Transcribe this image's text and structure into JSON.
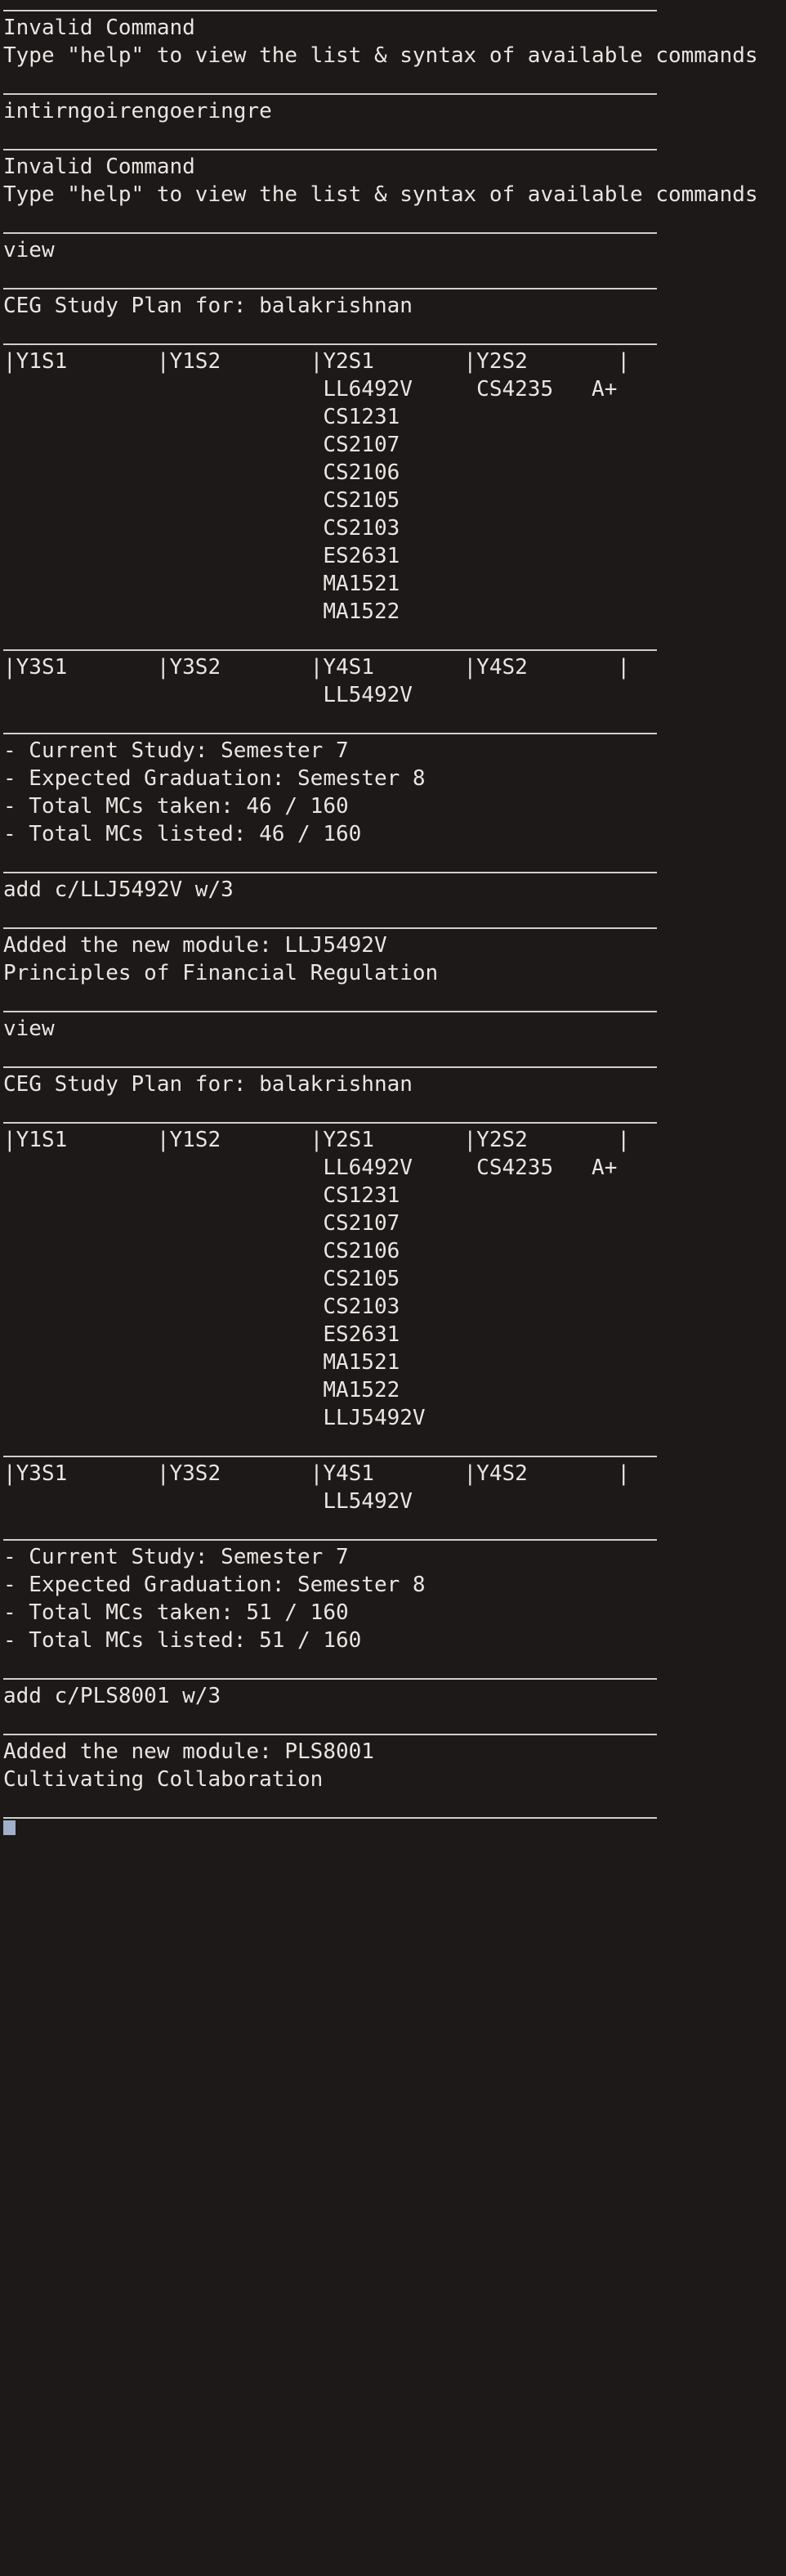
{
  "terminal": {
    "lines": [
      "Invalid Command",
      "Type \"help\" to view the list & syntax of available commands",
      "intirngoirengoeringre",
      "Invalid Command",
      "Type \"help\" to view the list & syntax of available commands",
      "view",
      "CEG Study Plan for: balakrishnan",
      "|Y1S1       |Y1S2       |Y2S1       |Y2S2       |",
      "                         LL6492V     CS4235   A+",
      "                         CS1231",
      "                         CS2107",
      "                         CS2106",
      "                         CS2105",
      "                         CS2103",
      "                         ES2631",
      "                         MA1521",
      "                         MA1522",
      "|Y3S1       |Y3S2       |Y4S1       |Y4S2       |",
      "                         LL5492V",
      "- Current Study: Semester 7",
      "- Expected Graduation: Semester 8",
      "- Total MCs taken: 46 / 160",
      "- Total MCs listed: 46 / 160",
      "add c/LLJ5492V w/3",
      "Added the new module: LLJ5492V",
      "Principles of Financial Regulation",
      "view",
      "CEG Study Plan for: balakrishnan",
      "|Y1S1       |Y1S2       |Y2S1       |Y2S2       |",
      "                         LL6492V     CS4235   A+",
      "                         CS1231",
      "                         CS2107",
      "                         CS2106",
      "                         CS2105",
      "                         CS2103",
      "                         ES2631",
      "                         MA1521",
      "                         MA1522",
      "                         LLJ5492V",
      "|Y3S1       |Y3S2       |Y4S1       |Y4S2       |",
      "                         LL5492V",
      "- Current Study: Semester 7",
      "- Expected Graduation: Semester 8",
      "- Total MCs taken: 51 / 160",
      "- Total MCs listed: 51 / 160",
      "add c/PLS8001 w/3",
      "Added the new module: PLS8001",
      "Cultivating Collaboration"
    ]
  }
}
